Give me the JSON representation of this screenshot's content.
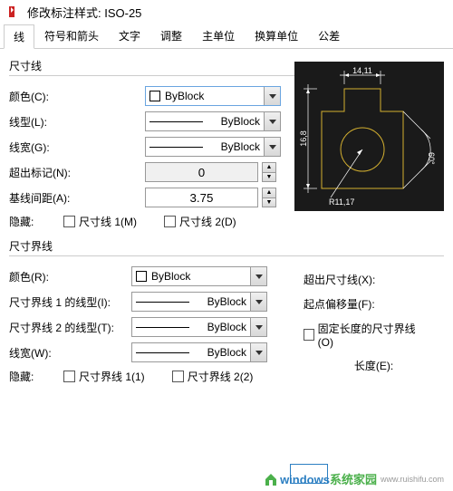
{
  "title": "修改标注样式: ISO-25",
  "tabs": [
    "线",
    "符号和箭头",
    "文字",
    "调整",
    "主单位",
    "换算单位",
    "公差"
  ],
  "active_tab": 0,
  "dimline": {
    "group_label": "尺寸线",
    "color_label": "颜色(C):",
    "color_value": "ByBlock",
    "linetype_label": "线型(L):",
    "linetype_value": "ByBlock",
    "lineweight_label": "线宽(G):",
    "lineweight_value": "ByBlock",
    "extend_label": "超出标记(N):",
    "extend_value": "0",
    "baseline_label": "基线间距(A):",
    "baseline_value": "3.75",
    "hide_label": "隐藏:",
    "hide_chk1": "尺寸线 1(M)",
    "hide_chk2": "尺寸线 2(D)"
  },
  "extline": {
    "group_label": "尺寸界线",
    "color_label": "颜色(R):",
    "color_value": "ByBlock",
    "lt1_label": "尺寸界线 1 的线型(I):",
    "lt1_value": "ByBlock",
    "lt2_label": "尺寸界线 2 的线型(T):",
    "lt2_value": "ByBlock",
    "lw_label": "线宽(W):",
    "lw_value": "ByBlock",
    "hide_label": "隐藏:",
    "hide_chk1": "尺寸界线 1(1)",
    "hide_chk2": "尺寸界线 2(2)",
    "beyond_label": "超出尺寸线(X):",
    "offset_label": "起点偏移量(F):",
    "fixed_label": "固定长度的尺寸界线(O)",
    "length_label": "长度(E):"
  },
  "preview": {
    "dim_top": "14,11",
    "dim_left": "16,8",
    "dim_radius": "R11,17",
    "dim_angle": "60°"
  },
  "footer": {
    "brand1": "windows",
    "brand2": "系统家园",
    "url": "www.ruishifu.com"
  }
}
